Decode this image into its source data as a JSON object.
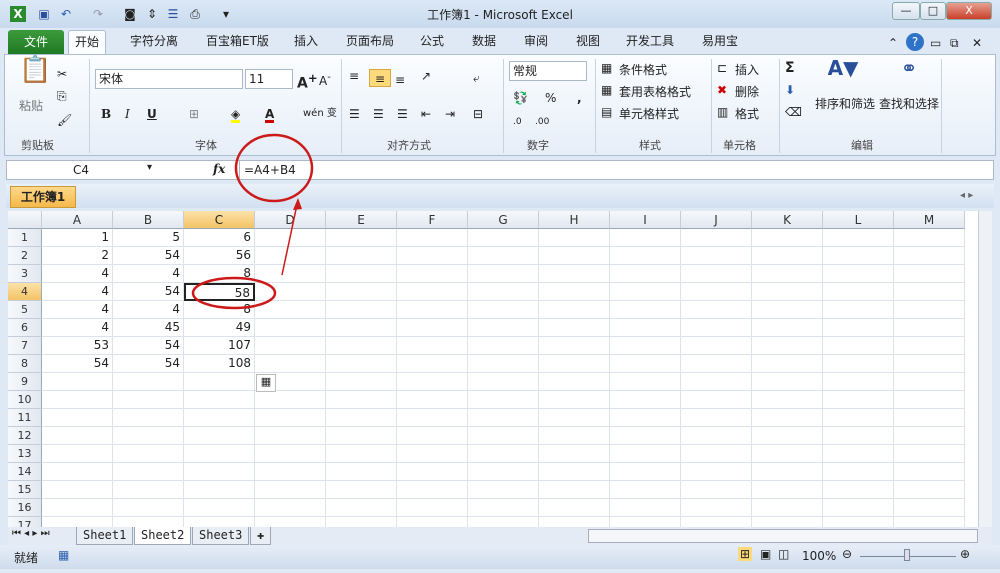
{
  "window": {
    "title": "工作簿1  -  Microsoft Excel",
    "minimize": "—",
    "maximize": "□",
    "close": "X"
  },
  "quick_access": [
    "excel-icon",
    "save-icon",
    "undo-icon",
    "redo-icon",
    "camera-icon",
    "sort-icon",
    "form-icon",
    "print-icon",
    "customize-icon"
  ],
  "tabs": {
    "file": "文件",
    "items": [
      "开始",
      "字符分离",
      "百宝箱ET版",
      "插入",
      "页面布局",
      "公式",
      "数据",
      "审阅",
      "视图",
      "开发工具",
      "易用宝"
    ]
  },
  "ribbon": {
    "clipboard": {
      "label": "剪贴板",
      "paste": "粘贴"
    },
    "font": {
      "label": "字体",
      "name": "宋体",
      "size": "11",
      "bold": "B",
      "italic": "I",
      "underline": "U",
      "phonetic": "wén 变"
    },
    "alignment": {
      "label": "对齐方式"
    },
    "number": {
      "label": "数字",
      "format": "常规",
      "percent": "%",
      "comma": ","
    },
    "styles": {
      "label": "样式",
      "conditional": "条件格式",
      "table": "套用表格格式",
      "cell": "单元格样式"
    },
    "cells": {
      "label": "单元格",
      "insert": "插入",
      "delete": "删除",
      "format": "格式"
    },
    "editing": {
      "label": "编辑",
      "sigma": "Σ",
      "sort": "排序和筛选",
      "find": "查找和选择"
    }
  },
  "formula_bar": {
    "name_box": "C4",
    "fx": "fx",
    "formula": "=A4+B4"
  },
  "workbook_tab": "工作簿1",
  "grid": {
    "columns": [
      "A",
      "B",
      "C",
      "D",
      "E",
      "F",
      "G",
      "H",
      "I",
      "J",
      "K",
      "L",
      "M"
    ],
    "rows": [
      "1",
      "2",
      "3",
      "4",
      "5",
      "6",
      "7",
      "8",
      "9",
      "10",
      "11",
      "12",
      "13",
      "14",
      "15",
      "16",
      "17"
    ],
    "selected_cell": "C4",
    "cells": [
      [
        "1",
        "5",
        "6"
      ],
      [
        "2",
        "54",
        "56"
      ],
      [
        "4",
        "4",
        "8"
      ],
      [
        "4",
        "54",
        "58"
      ],
      [
        "4",
        "4",
        "8"
      ],
      [
        "4",
        "45",
        "49"
      ],
      [
        "53",
        "54",
        "107"
      ],
      [
        "54",
        "54",
        "108"
      ]
    ]
  },
  "sheets": [
    "Sheet1",
    "Sheet2",
    "Sheet3"
  ],
  "active_sheet": "Sheet2",
  "status": {
    "ready": "就绪",
    "zoom": "100%"
  },
  "colors": {
    "file_tab": "#2a8a2e",
    "selection": "#f5c46a",
    "annotation": "#cc1a1a"
  }
}
